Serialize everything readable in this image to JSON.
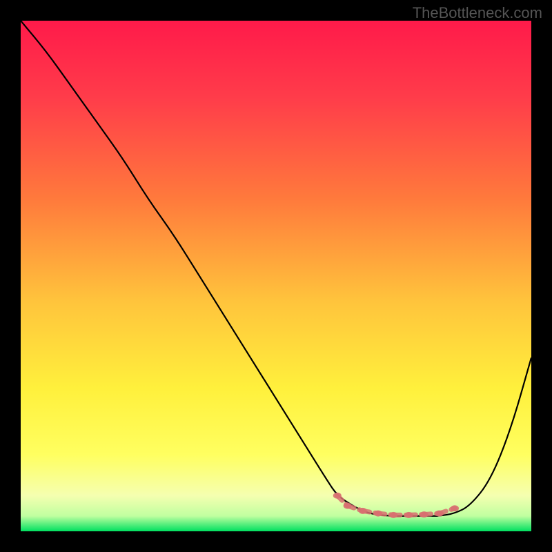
{
  "watermark": "TheBottleneck.com",
  "chart_data": {
    "type": "line",
    "title": "",
    "xlabel": "",
    "ylabel": "",
    "xlim": [
      0,
      100
    ],
    "ylim": [
      0,
      100
    ],
    "grid": false,
    "legend": false,
    "background_gradient": {
      "stops": [
        {
          "offset": 0,
          "color": "#ff1a4a"
        },
        {
          "offset": 0.15,
          "color": "#ff3c4a"
        },
        {
          "offset": 0.35,
          "color": "#ff7a3c"
        },
        {
          "offset": 0.55,
          "color": "#ffc43c"
        },
        {
          "offset": 0.72,
          "color": "#fff03c"
        },
        {
          "offset": 0.85,
          "color": "#ffff60"
        },
        {
          "offset": 0.93,
          "color": "#f5ffb0"
        },
        {
          "offset": 0.97,
          "color": "#c0ffa0"
        },
        {
          "offset": 1.0,
          "color": "#00e060"
        }
      ]
    },
    "series": [
      {
        "name": "bottleneck-curve",
        "color": "#000000",
        "x": [
          0,
          5,
          10,
          15,
          20,
          25,
          30,
          35,
          40,
          45,
          50,
          55,
          60,
          62,
          65,
          68,
          72,
          75,
          78,
          80,
          82,
          85,
          88,
          92,
          96,
          100
        ],
        "y": [
          100,
          94,
          87,
          80,
          73,
          65,
          58,
          50,
          42,
          34,
          26,
          18,
          10,
          7,
          5,
          3.5,
          3,
          3,
          3,
          3,
          3,
          3.5,
          5,
          10,
          20,
          34
        ]
      }
    ],
    "markers": {
      "color": "#d87070",
      "points": [
        {
          "x": 62,
          "y": 7
        },
        {
          "x": 64,
          "y": 5
        },
        {
          "x": 67,
          "y": 4
        },
        {
          "x": 70,
          "y": 3.5
        },
        {
          "x": 73,
          "y": 3.2
        },
        {
          "x": 76,
          "y": 3.2
        },
        {
          "x": 79,
          "y": 3.3
        },
        {
          "x": 82,
          "y": 3.5
        },
        {
          "x": 85,
          "y": 4.5
        }
      ]
    }
  }
}
